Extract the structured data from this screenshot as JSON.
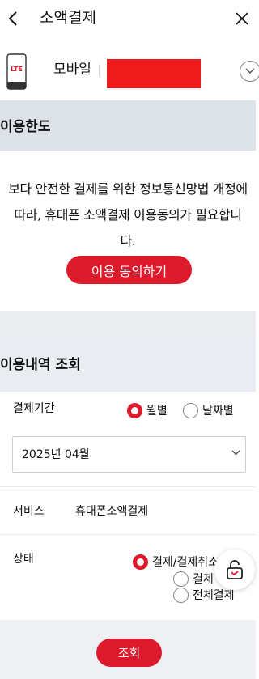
{
  "header": {
    "title": "소액결제"
  },
  "device": {
    "phone_badge": "LTE",
    "name": "모바일"
  },
  "limit_section": {
    "title": "이용한도",
    "notice": "보다 안전한 결제를 위한 정보통신망법 개정에 따라, 휴대폰 소액결제 이용동의가 필요합니다.",
    "agree_button": "이용 동의하기"
  },
  "history_section": {
    "title": "이용내역 조회",
    "period": {
      "label": "결제기간",
      "options": [
        "월별",
        "날짜별"
      ],
      "selected": "월별",
      "month_value": "2025년 04월"
    },
    "service": {
      "label": "서비스",
      "value": "휴대폰소액결제"
    },
    "status": {
      "label": "상태",
      "options": [
        "결제/결제취소",
        "결제",
        "전체결제"
      ],
      "selected": "결제/결제취소"
    },
    "search_button": "조회"
  },
  "colors": {
    "accent": "#dd1a2b",
    "band": "#dde1e8",
    "redacted": "#ee1c1c"
  },
  "icons": {
    "back": "chevron-left-icon",
    "close": "close-icon",
    "expand": "chevron-down-icon",
    "phone": "phone-icon",
    "lock": "unlock-icon"
  }
}
